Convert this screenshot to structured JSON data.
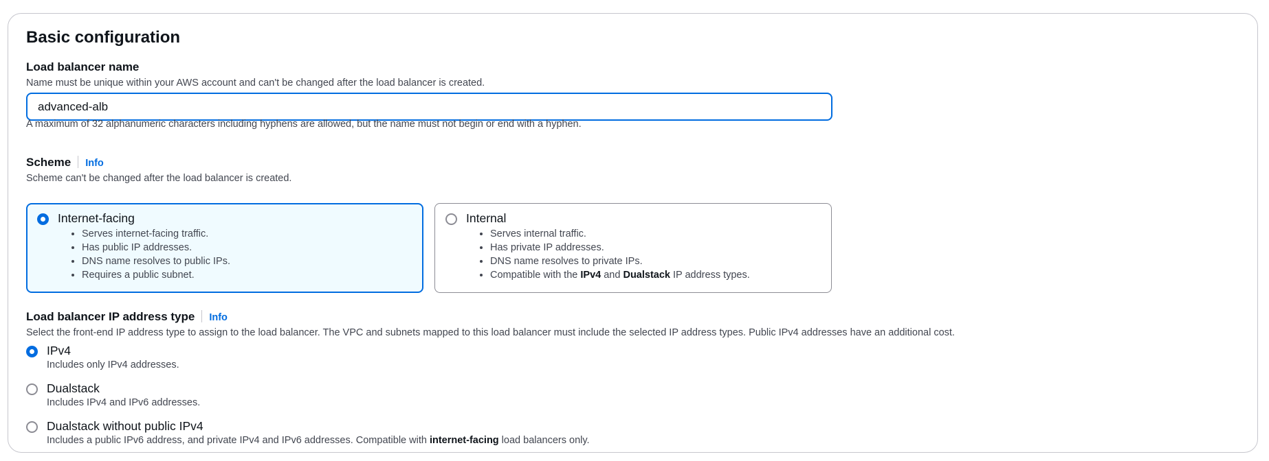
{
  "section": {
    "title": "Basic configuration"
  },
  "name_field": {
    "label": "Load balancer name",
    "description": "Name must be unique within your AWS account and can't be changed after the load balancer is created.",
    "value": "advanced-alb",
    "constraint": "A maximum of 32 alphanumeric characters including hyphens are allowed, but the name must not begin or end with a hyphen."
  },
  "scheme": {
    "label": "Scheme",
    "info": "Info",
    "description": "Scheme can't be changed after the load balancer is created.",
    "options": [
      {
        "title": "Internet-facing",
        "selected": true,
        "bullets": [
          "Serves internet-facing traffic.",
          "Has public IP addresses.",
          "DNS name resolves to public IPs.",
          "Requires a public subnet."
        ]
      },
      {
        "title": "Internal",
        "selected": false,
        "bullets": [
          "Serves internal traffic.",
          "Has private IP addresses.",
          "DNS name resolves to private IPs."
        ],
        "last_bullet": {
          "prefix": "Compatible with the ",
          "bold1": "IPv4",
          "mid": " and ",
          "bold2": "Dualstack",
          "suffix": " IP address types."
        }
      }
    ]
  },
  "ip_type": {
    "label": "Load balancer IP address type",
    "info": "Info",
    "description": "Select the front-end IP address type to assign to the load balancer. The VPC and subnets mapped to this load balancer must include the selected IP address types. Public IPv4 addresses have an additional cost.",
    "options": [
      {
        "label": "IPv4",
        "description": "Includes only IPv4 addresses.",
        "selected": true
      },
      {
        "label": "Dualstack",
        "description": "Includes IPv4 and IPv6 addresses.",
        "selected": false
      },
      {
        "label": "Dualstack without public IPv4",
        "selected": false,
        "description_parts": {
          "prefix": "Includes a public IPv6 address, and private IPv4 and IPv6 addresses. Compatible with ",
          "bold": "internet-facing",
          "suffix": " load balancers only."
        }
      }
    ]
  },
  "colors": {
    "accent": "#006ce0",
    "selected_tile_bg": "#f0fbff",
    "text": "#0f141a",
    "muted": "#424650",
    "border": "#8c8c94"
  }
}
